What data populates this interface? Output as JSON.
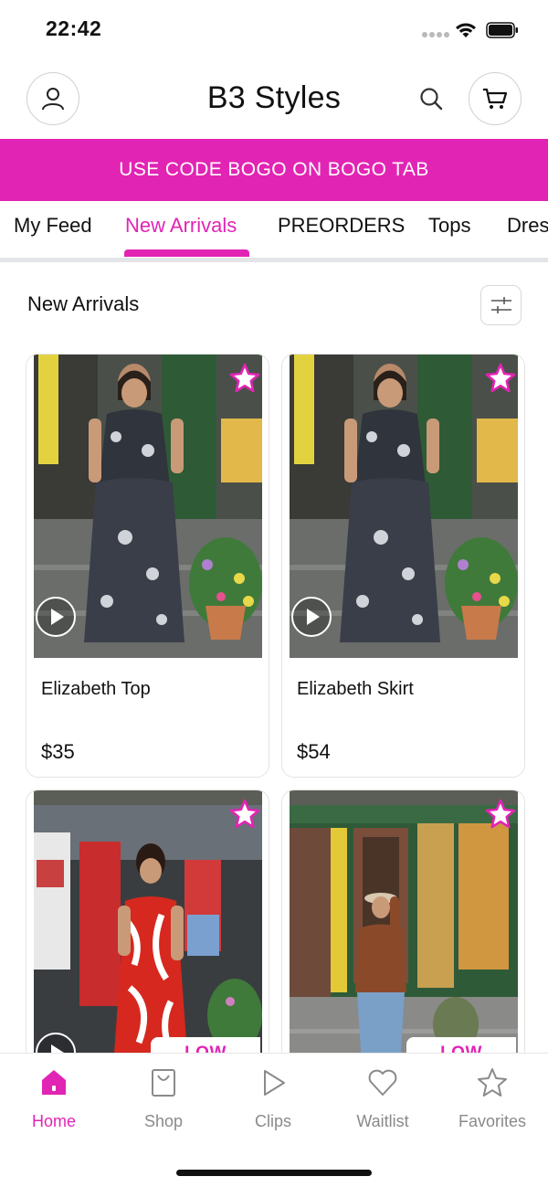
{
  "status": {
    "time": "22:42"
  },
  "header": {
    "title": "B3 Styles"
  },
  "promo": {
    "text": "USE CODE BOGO ON BOGO TAB"
  },
  "tabs": [
    {
      "label": "My Feed",
      "active": false
    },
    {
      "label": "New Arrivals",
      "active": true
    },
    {
      "label": "PREORDERS",
      "active": false
    },
    {
      "label": "Tops",
      "active": false
    },
    {
      "label": "Dres",
      "active": false
    }
  ],
  "section": {
    "title": "New Arrivals"
  },
  "products": [
    {
      "name": "Elizabeth Top",
      "price": "$35",
      "favorite_icon": "star-icon",
      "has_video": true
    },
    {
      "name": "Elizabeth Skirt",
      "price": "$54",
      "favorite_icon": "star-icon",
      "has_video": true
    },
    {
      "badge": "LOW STOCK",
      "favorite_icon": "star-icon",
      "has_video": true
    },
    {
      "badge": "LOW STOCK",
      "favorite_icon": "star-icon",
      "has_video": false
    }
  ],
  "bottom_nav": [
    {
      "label": "Home",
      "icon": "home-icon",
      "active": true
    },
    {
      "label": "Shop",
      "icon": "shopping-bag-icon",
      "active": false
    },
    {
      "label": "Clips",
      "icon": "play-icon",
      "active": false
    },
    {
      "label": "Waitlist",
      "icon": "heart-icon",
      "active": false
    },
    {
      "label": "Favorites",
      "icon": "star-icon",
      "active": false
    }
  ],
  "colors": {
    "accent": "#e224b4",
    "divider": "#e3e5e8",
    "inactive": "#8a8a8a"
  }
}
